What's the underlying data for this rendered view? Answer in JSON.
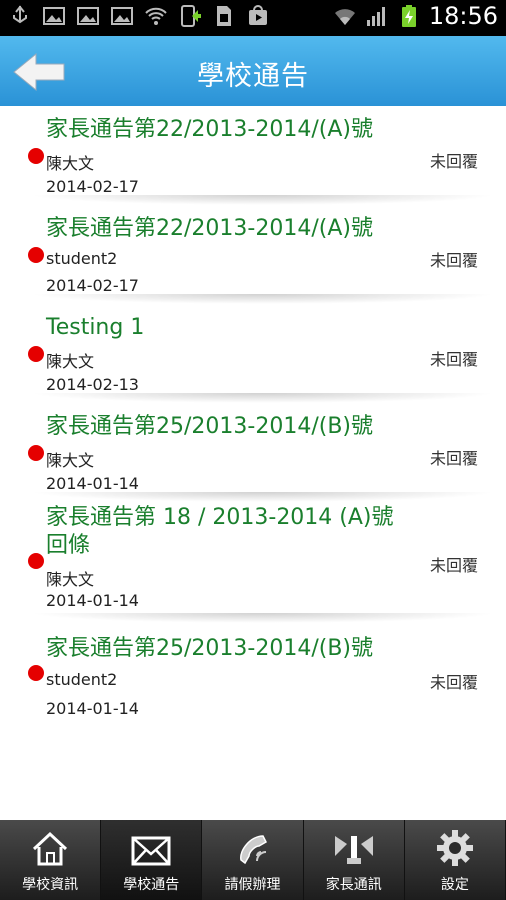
{
  "status_bar": {
    "time": "18:56",
    "icons": [
      "usb-icon",
      "image-icon",
      "image-icon",
      "image-icon",
      "wifi-icon",
      "phone-sync-icon",
      "sim-icon",
      "play-store-icon",
      "wifi-signal-icon",
      "cell-signal-icon",
      "battery-charging-icon"
    ]
  },
  "header": {
    "title": "學校通告"
  },
  "notices": [
    {
      "subject": "家長通告第22/2013-2014/(A)號",
      "sender": "陳大文",
      "date": "2014-02-17",
      "status": "未回覆"
    },
    {
      "subject": "家長通告第22/2013-2014/(A)號",
      "sender": "student2",
      "date": "2014-02-17",
      "status": "未回覆"
    },
    {
      "subject": "Testing 1",
      "sender": "陳大文",
      "date": "2014-02-13",
      "status": "未回覆"
    },
    {
      "subject": "家長通告第25/2013-2014/(B)號",
      "sender": "陳大文",
      "date": "2014-01-14",
      "status": "未回覆"
    },
    {
      "subject": "家長通告第 18 / 2013-2014 (A)號回條",
      "sender": "陳大文",
      "date": "2014-01-14",
      "status": "未回覆"
    },
    {
      "subject": "家長通告第25/2013-2014/(B)號",
      "sender": "student2",
      "date": "2014-01-14",
      "status": "未回覆"
    }
  ],
  "tabs": [
    {
      "label": "學校資訊",
      "icon": "home-icon"
    },
    {
      "label": "學校通告",
      "icon": "envelope-icon"
    },
    {
      "label": "請假辦理",
      "icon": "phone-handset-icon"
    },
    {
      "label": "家長通訊",
      "icon": "contacts-icon"
    },
    {
      "label": "設定",
      "icon": "gear-icon"
    }
  ],
  "colors": {
    "header": "#2a92d6",
    "subject": "#1a7f2d",
    "unread_dot": "#e50000",
    "tabbar": "#2b2b2b"
  }
}
